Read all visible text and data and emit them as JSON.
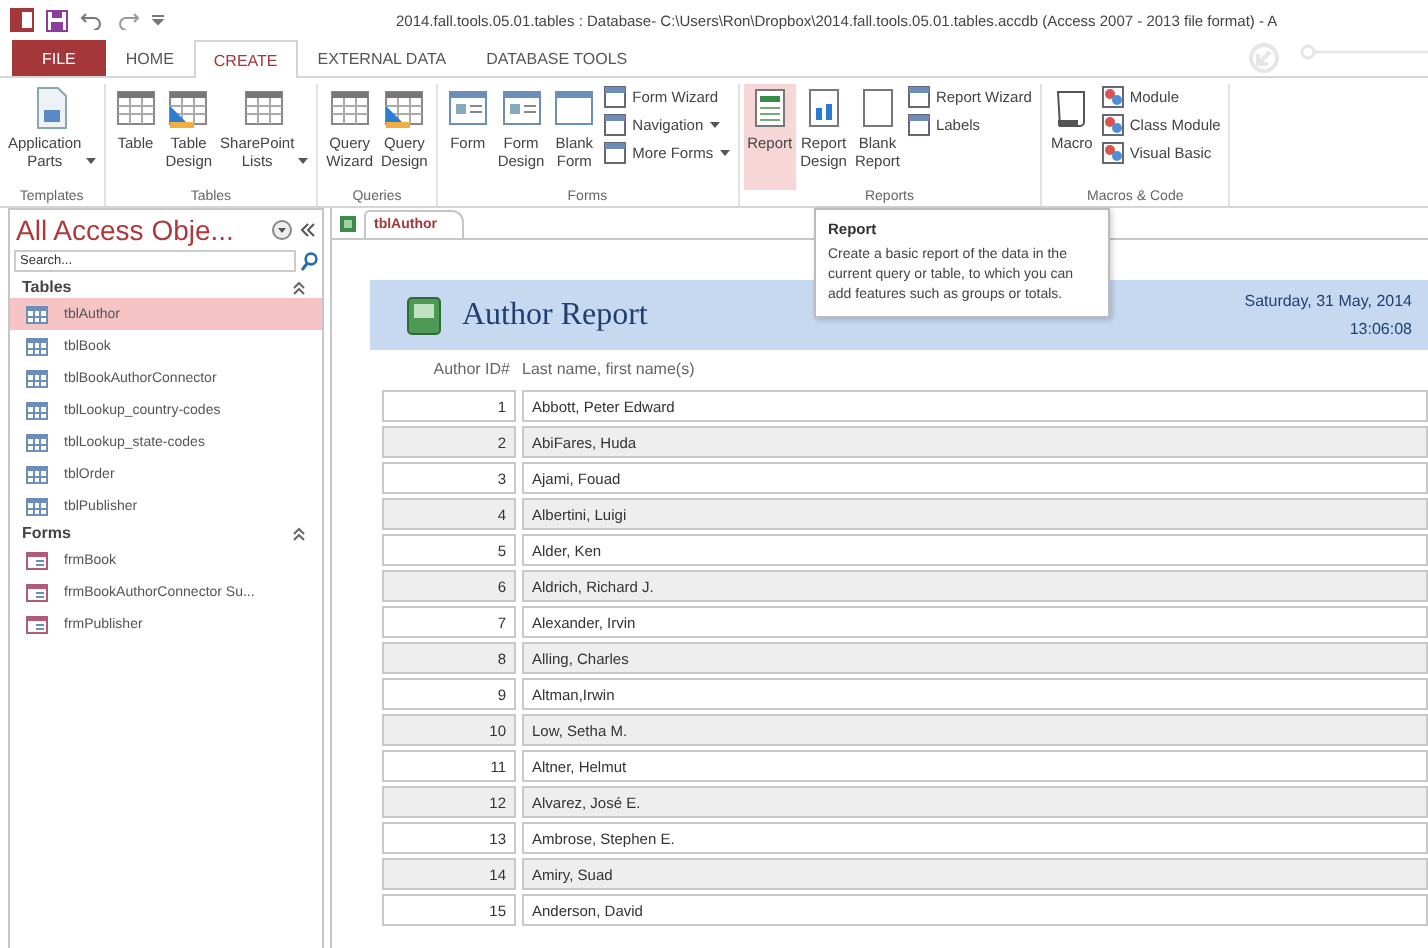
{
  "window": {
    "title": "2014.fall.tools.05.01.tables : Database- C:\\Users\\Ron\\Dropbox\\2014.fall.tools.05.01.tables.accdb (Access 2007 - 2013 file format) - A"
  },
  "tabs": [
    {
      "label": "FILE",
      "kind": "file",
      "selected": false
    },
    {
      "label": "HOME",
      "kind": "tab",
      "selected": false
    },
    {
      "label": "CREATE",
      "kind": "tab",
      "selected": true
    },
    {
      "label": "EXTERNAL DATA",
      "kind": "tab",
      "selected": false
    },
    {
      "label": "DATABASE TOOLS",
      "kind": "tab",
      "selected": false
    }
  ],
  "ribbon": {
    "groups": [
      {
        "name": "Templates",
        "items": [
          {
            "kind": "large",
            "label": "Application Parts",
            "dropdown": true,
            "hovered": false
          }
        ]
      },
      {
        "name": "Tables",
        "items": [
          {
            "kind": "large",
            "label": "Table",
            "dropdown": false,
            "hovered": false
          },
          {
            "kind": "large",
            "label": "Table Design",
            "dropdown": false,
            "hovered": false
          },
          {
            "kind": "large",
            "label": "SharePoint Lists",
            "dropdown": true,
            "hovered": false
          }
        ]
      },
      {
        "name": "Queries",
        "items": [
          {
            "kind": "large",
            "label": "Query Wizard",
            "dropdown": false,
            "hovered": false
          },
          {
            "kind": "large",
            "label": "Query Design",
            "dropdown": false,
            "hovered": false
          }
        ]
      },
      {
        "name": "Forms",
        "items": [
          {
            "kind": "large",
            "label": "Form",
            "dropdown": false,
            "hovered": false
          },
          {
            "kind": "large",
            "label": "Form Design",
            "dropdown": false,
            "hovered": false
          },
          {
            "kind": "large",
            "label": "Blank Form",
            "dropdown": false,
            "hovered": false
          },
          {
            "kind": "small",
            "label": "Form Wizard",
            "dropdown": false,
            "hovered": false
          },
          {
            "kind": "small",
            "label": "Navigation",
            "dropdown": true,
            "hovered": false
          },
          {
            "kind": "small",
            "label": "More Forms",
            "dropdown": true,
            "hovered": false
          }
        ]
      },
      {
        "name": "Reports",
        "items": [
          {
            "kind": "large",
            "label": "Report",
            "dropdown": false,
            "hovered": true
          },
          {
            "kind": "large",
            "label": "Report Design",
            "dropdown": false,
            "hovered": false
          },
          {
            "kind": "large",
            "label": "Blank Report",
            "dropdown": false,
            "hovered": false
          },
          {
            "kind": "small",
            "label": "Report Wizard",
            "dropdown": false,
            "hovered": false
          },
          {
            "kind": "small",
            "label": "Labels",
            "dropdown": false,
            "hovered": false
          }
        ]
      },
      {
        "name": "Macros & Code",
        "items": [
          {
            "kind": "large",
            "label": "Macro",
            "dropdown": false,
            "hovered": false
          },
          {
            "kind": "small",
            "label": "Module",
            "dropdown": false,
            "hovered": false
          },
          {
            "kind": "small",
            "label": "Class Module",
            "dropdown": false,
            "hovered": false
          },
          {
            "kind": "small",
            "label": "Visual Basic",
            "dropdown": false,
            "hovered": false
          }
        ]
      }
    ]
  },
  "navigation_pane": {
    "title": "All Access Obje...",
    "search": {
      "placeholder": "Search..."
    },
    "sections": [
      {
        "name": "Tables",
        "expanded": true,
        "kind": "table",
        "items": [
          {
            "label": "tblAuthor",
            "selected": true
          },
          {
            "label": "tblBook",
            "selected": false
          },
          {
            "label": "tblBookAuthorConnector",
            "selected": false
          },
          {
            "label": "tblLookup_country-codes",
            "selected": false
          },
          {
            "label": "tblLookup_state-codes",
            "selected": false
          },
          {
            "label": "tblOrder",
            "selected": false
          },
          {
            "label": "tblPublisher",
            "selected": false
          }
        ]
      },
      {
        "name": "Forms",
        "expanded": true,
        "kind": "form",
        "items": [
          {
            "label": "frmBook",
            "selected": false
          },
          {
            "label": "frmBookAuthorConnector Su...",
            "selected": false
          },
          {
            "label": "frmPublisher",
            "selected": false
          }
        ]
      }
    ]
  },
  "document_tab": {
    "label": "tblAuthor"
  },
  "report": {
    "title": "Author Report",
    "date": "Saturday, 31 May, 2014",
    "time": "13:06:08",
    "columns": [
      "Author ID#",
      "Last name, first name(s)"
    ],
    "rows": [
      [
        "1",
        "Abbott, Peter Edward"
      ],
      [
        "2",
        "AbiFares, Huda"
      ],
      [
        "3",
        "Ajami, Fouad"
      ],
      [
        "4",
        "Albertini, Luigi"
      ],
      [
        "5",
        "Alder, Ken"
      ],
      [
        "6",
        "Aldrich, Richard J."
      ],
      [
        "7",
        "Alexander, Irvin"
      ],
      [
        "8",
        "Alling, Charles"
      ],
      [
        "9",
        "Altman,Irwin"
      ],
      [
        "10",
        "Low, Setha M."
      ],
      [
        "11",
        "Altner, Helmut"
      ],
      [
        "12",
        "Alvarez, José E."
      ],
      [
        "13",
        "Ambrose, Stephen E."
      ],
      [
        "14",
        "Amiry, Suad"
      ],
      [
        "15",
        "Anderson, David"
      ]
    ]
  },
  "tooltip": {
    "title": "Report",
    "text": "Create a basic report of the data in the current query or table, to which you can add features such as groups or totals."
  }
}
